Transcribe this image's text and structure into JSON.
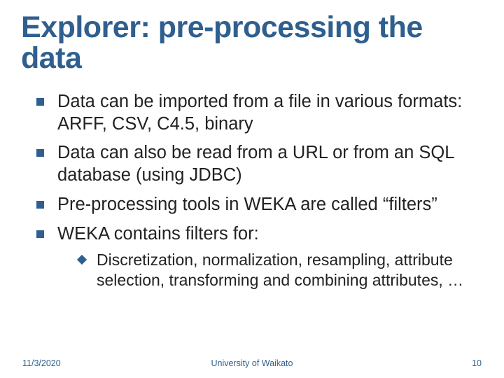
{
  "title": "Explorer: pre-processing the data",
  "bullets": [
    {
      "text": "Data can be imported from a file in various formats: ARFF, CSV, C4.5, binary"
    },
    {
      "text": "Data can also be read from a URL or from an SQL database (using JDBC)"
    },
    {
      "text": "Pre-processing tools in WEKA are called “filters”"
    },
    {
      "text": "WEKA contains filters for:",
      "sub": [
        "Discretization, normalization, resampling, attribute selection, transforming and combining attributes, …"
      ]
    }
  ],
  "footer": {
    "date": "11/3/2020",
    "org": "University of Waikato",
    "page": "10"
  }
}
